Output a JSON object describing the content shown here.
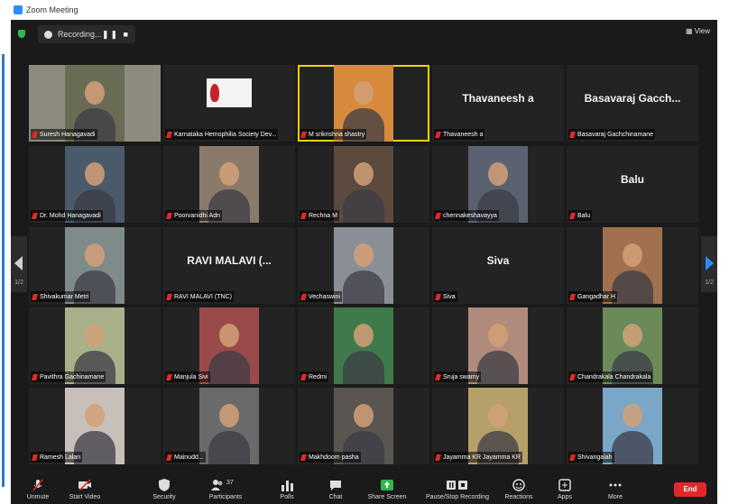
{
  "window": {
    "title": "Zoom Meeting"
  },
  "meeting_bar": {
    "recording_label": "Recording...",
    "recording_controls": "❚❚ ■",
    "view_label": "View"
  },
  "navigation": {
    "left_page": "1/2",
    "right_page": "1/2"
  },
  "participants": [
    {
      "label": "Suresh Hanagavadi",
      "bg": "#8d8a7f",
      "photo": "#6a6b55"
    },
    {
      "label": "Karnataka Hemophilia Society Dev...",
      "bg": "#232323",
      "photo": "#f4f4f4",
      "logo": "Karnataka Hemophilia Society"
    },
    {
      "label": "M srikrishna shastry",
      "bg": "#232323",
      "photo": "#d78a3b",
      "active": true
    },
    {
      "label": "Thavaneesh a",
      "display_name": "Thavaneesh a",
      "bg": "#232323"
    },
    {
      "label": "Basavaraj Gachchinamane",
      "display_name": "Basavaraj  Gacch...",
      "bg": "#232323"
    },
    {
      "label": "Dr. Mohd Hanagavadi",
      "bg": "#232323",
      "photo": "#4a5a6a"
    },
    {
      "label": "Poorvanidhi Adn",
      "bg": "#232323",
      "photo": "#8a7a6a"
    },
    {
      "label": "Rechna M",
      "bg": "#232323",
      "photo": "#5b4a3d"
    },
    {
      "label": "chennakeshavayya",
      "bg": "#232323",
      "photo": "#5a6272"
    },
    {
      "label": "Balu",
      "display_name": "Balu",
      "bg": "#232323"
    },
    {
      "label": "Shivakumar Metri",
      "bg": "#232323",
      "photo": "#7f8a8a"
    },
    {
      "label": "RAVI MALAVI (TNC)",
      "display_name": "RAVI MALAVI  (...",
      "bg": "#232323"
    },
    {
      "label": "Vechaswini",
      "bg": "#232323",
      "photo": "#8a8f96"
    },
    {
      "label": "Siva",
      "display_name": "Siva",
      "bg": "#232323"
    },
    {
      "label": "Gangadhar H",
      "bg": "#232323",
      "photo": "#a0704f"
    },
    {
      "label": "Pavithra Gachinamane",
      "bg": "#232323",
      "photo": "#a8b08a"
    },
    {
      "label": "Manjula Sivi",
      "bg": "#232323",
      "photo": "#9a4a4a"
    },
    {
      "label": "Redmi",
      "bg": "#232323",
      "photo": "#3e7a4a"
    },
    {
      "label": "Sruja swamy",
      "bg": "#232323",
      "photo": "#b08a7a"
    },
    {
      "label": "Chandrakala Chandrakala",
      "bg": "#232323",
      "photo": "#6a8a5a"
    },
    {
      "label": "Ramesh Lalan",
      "bg": "#232323",
      "photo": "#c8c0b8"
    },
    {
      "label": "Mainudd...",
      "bg": "#232323",
      "photo": "#6a6a6a"
    },
    {
      "label": "Makhdoom pasha",
      "bg": "#232323",
      "photo": "#5a5550"
    },
    {
      "label": "Jayamma KR Jayamma KR",
      "bg": "#232323",
      "photo": "#b6a06a"
    },
    {
      "label": "Shivangaiah",
      "bg": "#232323",
      "photo": "#7aa6c8"
    }
  ],
  "toolbar": {
    "unmute": "Unmute",
    "start_video": "Start Video",
    "security": "Security",
    "participants": "Participants",
    "participant_count": "37",
    "polls": "Polls",
    "chat": "Chat",
    "share_screen": "Share Screen",
    "recording": "Pause/Stop Recording",
    "reactions": "Reactions",
    "apps": "Apps",
    "more": "More",
    "end": "End"
  },
  "colors": {
    "active_speaker": "#f5d000",
    "muted_mic": "#e02828",
    "accent_blue": "#2d8cff",
    "share_green": "#2eb84b",
    "end_red": "#e02828"
  }
}
